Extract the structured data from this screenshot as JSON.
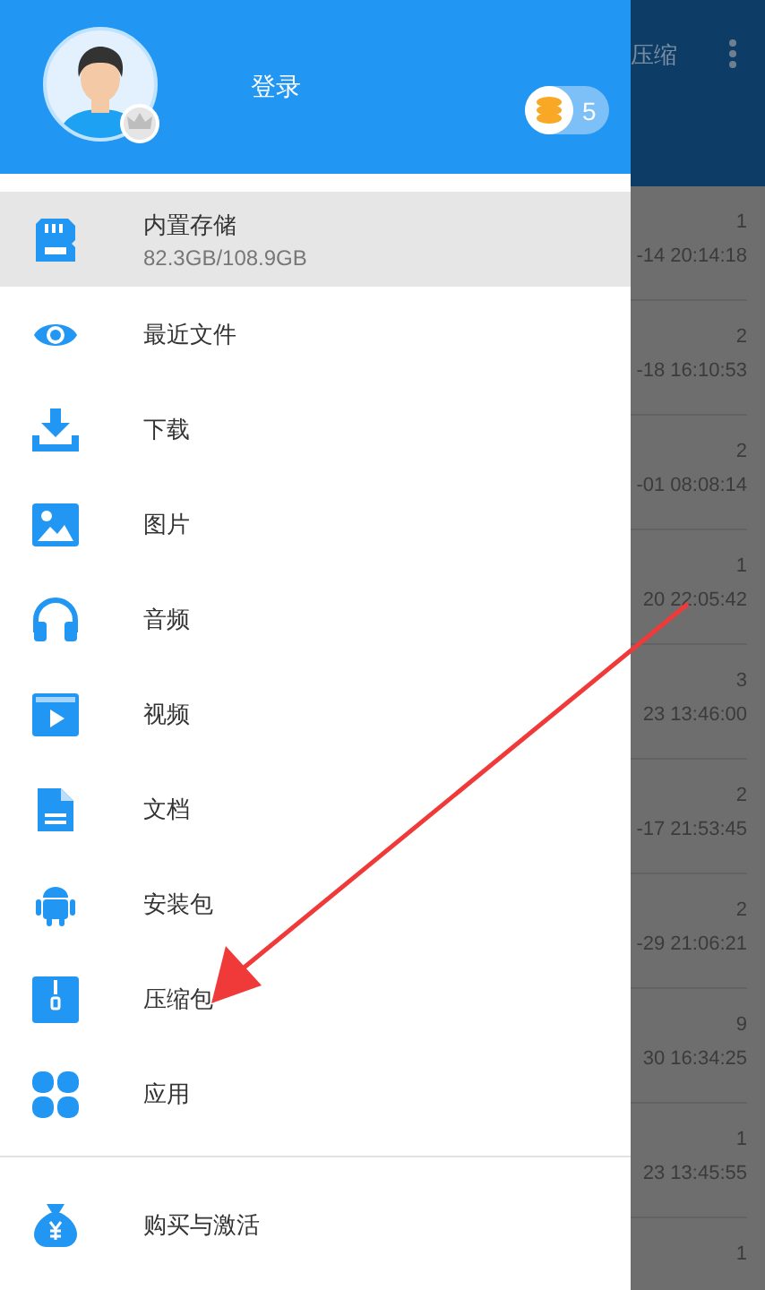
{
  "drawer": {
    "login_label": "登录",
    "coin_count": "5",
    "storage": {
      "title": "内置存储",
      "subtitle": "82.3GB/108.9GB",
      "selected": true
    },
    "items": [
      {
        "label": "最近文件",
        "selected": false
      },
      {
        "label": "下载",
        "selected": false
      },
      {
        "label": "图片",
        "selected": false
      },
      {
        "label": "音频",
        "selected": false
      },
      {
        "label": "视频",
        "selected": false
      },
      {
        "label": "文档",
        "selected": false
      },
      {
        "label": "安装包",
        "selected": false
      },
      {
        "label": "压缩包",
        "selected": false
      },
      {
        "label": "应用",
        "selected": false
      }
    ],
    "footer_items": [
      {
        "label": "购买与激活",
        "selected": false
      }
    ]
  },
  "background": {
    "title": "压缩",
    "rows": [
      {
        "count": "1",
        "date": "-14 20:14:18"
      },
      {
        "count": "2",
        "date": "-18 16:10:53"
      },
      {
        "count": "2",
        "date": "-01 08:08:14"
      },
      {
        "count": "1",
        "date": "20 22:05:42"
      },
      {
        "count": "3",
        "date": "23 13:46:00"
      },
      {
        "count": "2",
        "date": "-17 21:53:45"
      },
      {
        "count": "2",
        "date": "-29 21:06:21"
      },
      {
        "count": "9",
        "date": "30 16:34:25"
      },
      {
        "count": "1",
        "date": "23 13:45:55"
      },
      {
        "count": "1"
      }
    ]
  }
}
